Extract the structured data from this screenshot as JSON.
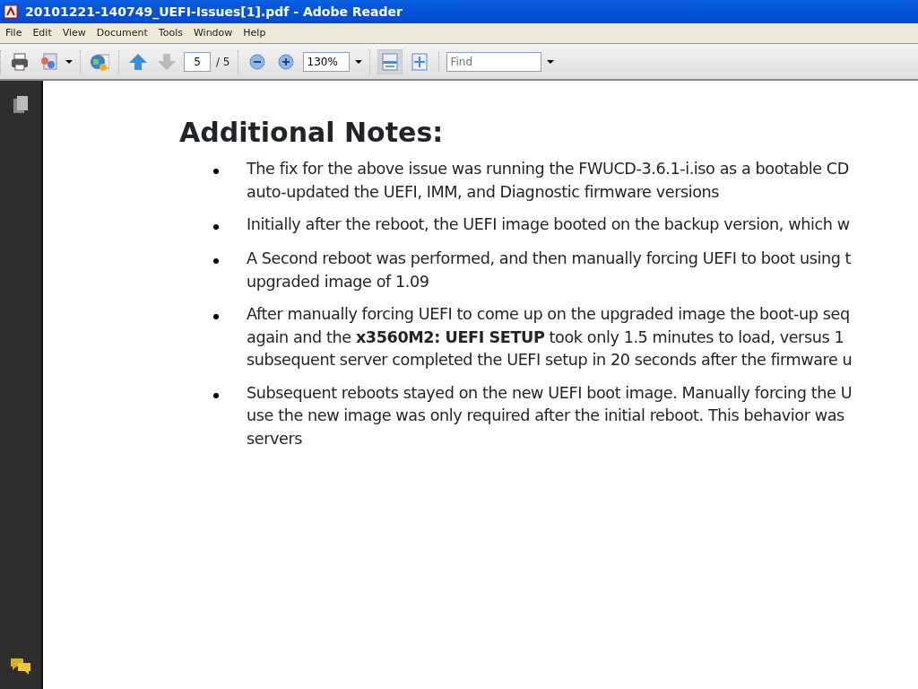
{
  "window": {
    "title": "20101221-140749_UEFI-Issues[1].pdf - Adobe Reader"
  },
  "menu": [
    "File",
    "Edit",
    "View",
    "Document",
    "Tools",
    "Window",
    "Help"
  ],
  "toolbar": {
    "groups": [
      [
        {
          "kind": "print"
        },
        {
          "kind": "share"
        }
      ],
      [
        {
          "kind": "globe"
        }
      ],
      [
        {
          "kind": "prev",
          "disabled": false
        },
        {
          "kind": "next",
          "disabled": true
        },
        {
          "kind": "page",
          "value": "5",
          "total": "/ 5"
        }
      ],
      [
        {
          "kind": "zoom-out"
        },
        {
          "kind": "zoom-in"
        },
        {
          "kind": "zoom",
          "value": "130%"
        }
      ],
      [
        {
          "kind": "fit-width",
          "selected": true
        },
        {
          "kind": "fit-page",
          "selected": false
        }
      ],
      [
        {
          "kind": "find",
          "placeholder": "Find"
        }
      ]
    ]
  },
  "document": {
    "heading": "Additional Notes:",
    "bullets": [
      {
        "lines": [
          "The fix for the above issue was running the FWUCD-3.6.1-i.iso as a bootable CD",
          "auto-updated the UEFI, IMM, and Diagnostic firmware versions"
        ]
      },
      {
        "lines": [
          "Initially after the reboot, the UEFI image booted on the backup version, which w"
        ]
      },
      {
        "lines": [
          "A Second reboot was performed, and then manually forcing UEFI to boot using t",
          "upgraded image of 1.09"
        ]
      },
      {
        "lines": [
          "After manually forcing UEFI to come up on the upgraded image the boot-up seq",
          "again and the **x3560M2: UEFI SETUP** took only 1.5 minutes to load, versus 1",
          "subsequent server completed the UEFI setup in 20 seconds after the firmware u"
        ]
      },
      {
        "lines": [
          "Subsequent reboots stayed on the new UEFI boot image. Manually forcing the U",
          "use the new image was only required after the initial reboot. This behavior was",
          "servers"
        ]
      }
    ]
  }
}
